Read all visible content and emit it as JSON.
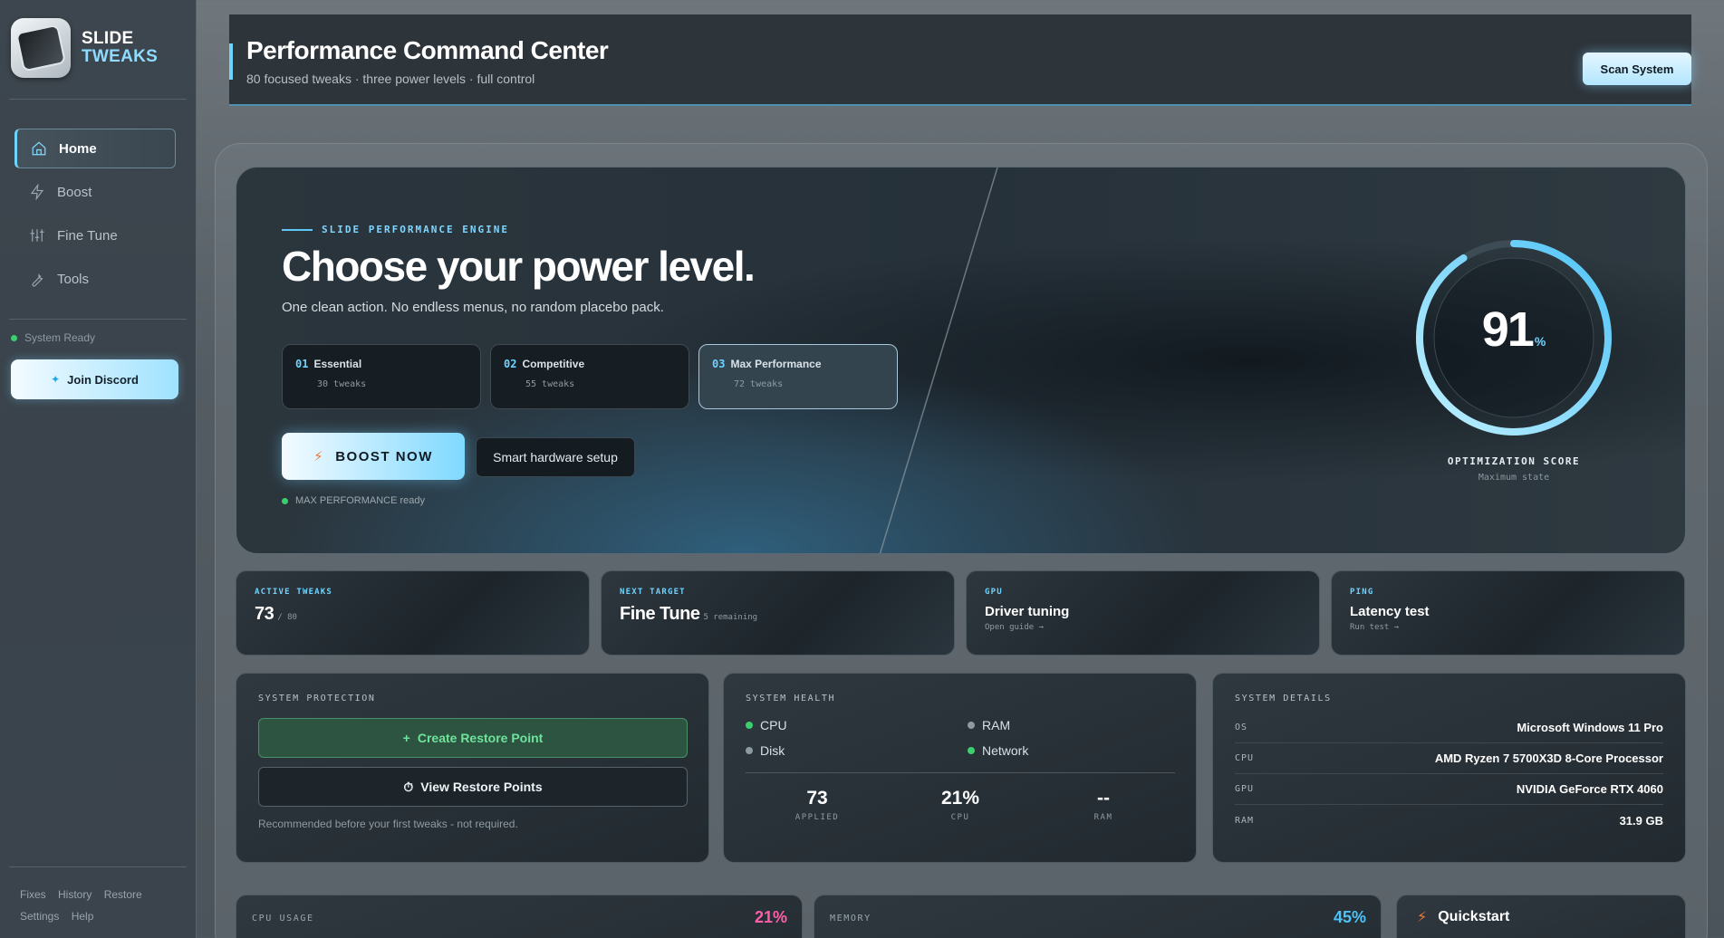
{
  "brand": {
    "line1": "SLIDE",
    "line2": "TWEAKS"
  },
  "nav": [
    {
      "label": "Home",
      "icon": "home-icon",
      "active": true
    },
    {
      "label": "Boost",
      "icon": "bolt-icon",
      "active": false
    },
    {
      "label": "Fine Tune",
      "icon": "sliders-icon",
      "active": false
    },
    {
      "label": "Tools",
      "icon": "wrench-icon",
      "active": false
    }
  ],
  "sidebar": {
    "status": "System Ready",
    "join_label": "Join Discord",
    "footer_row1": [
      "Fixes",
      "History",
      "Restore"
    ],
    "footer_row2": [
      "Settings",
      "Help"
    ]
  },
  "header": {
    "title": "Performance Command Center",
    "subtitle": "80 focused tweaks · three power levels · full control",
    "scan_label": "Scan System"
  },
  "hero": {
    "eyebrow": "SLIDE PERFORMANCE ENGINE",
    "title": "Choose your power level.",
    "subtitle": "One clean action. No endless menus, no random placebo pack.",
    "levels": [
      {
        "num": "01",
        "name": "Essential",
        "count": "30 tweaks",
        "active": false
      },
      {
        "num": "02",
        "name": "Competitive",
        "count": "55 tweaks",
        "active": false
      },
      {
        "num": "03",
        "name": "Max Performance",
        "count": "72 tweaks",
        "active": true
      }
    ],
    "boost_label": "BOOST NOW",
    "smart_label": "Smart hardware setup",
    "ready_note": "MAX PERFORMANCE ready"
  },
  "score": {
    "value": "91",
    "unit": "%",
    "fraction": 0.91,
    "label": "OPTIMIZATION SCORE",
    "sub": "Maximum state"
  },
  "tiles": [
    {
      "key": "ACTIVE TWEAKS",
      "value": "73",
      "aux": "/ 80",
      "sub": ""
    },
    {
      "key": "NEXT TARGET",
      "value": "Fine Tune",
      "aux": "5 remaining",
      "sub": ""
    },
    {
      "key": "GPU",
      "value": "Driver tuning",
      "aux": "",
      "sub": "Open guide →"
    },
    {
      "key": "PING",
      "value": "Latency test",
      "aux": "",
      "sub": "Run test →"
    }
  ],
  "protection": {
    "title": "SYSTEM PROTECTION",
    "create_label": "Create Restore Point",
    "view_label": "View Restore Points",
    "note": "Recommended before your first tweaks - not required."
  },
  "health": {
    "title": "SYSTEM HEALTH",
    "items": [
      {
        "label": "CPU",
        "color": "#3ccf6e"
      },
      {
        "label": "RAM",
        "color": "#8e9aa2"
      },
      {
        "label": "Disk",
        "color": "#8e9aa2"
      },
      {
        "label": "Network",
        "color": "#3ccf6e"
      }
    ],
    "stats": [
      {
        "value": "73",
        "label": "APPLIED"
      },
      {
        "value": "21%",
        "label": "CPU"
      },
      {
        "value": "--",
        "label": "RAM"
      }
    ]
  },
  "details": {
    "title": "SYSTEM DETAILS",
    "rows": [
      {
        "key": "OS",
        "value": "Microsoft Windows 11 Pro"
      },
      {
        "key": "CPU",
        "value": "AMD Ryzen 7 5700X3D 8-Core Processor"
      },
      {
        "key": "GPU",
        "value": "NVIDIA GeForce RTX 4060"
      },
      {
        "key": "RAM",
        "value": "31.9 GB"
      }
    ]
  },
  "bottom": {
    "cpu": {
      "title": "CPU USAGE",
      "value": "21%",
      "color": "#ff5fa8"
    },
    "memory": {
      "title": "MEMORY",
      "value": "45%",
      "color": "#4fc3f7"
    },
    "quickstart": {
      "title": "Quickstart"
    }
  },
  "colors": {
    "accent": "#6fd3ff",
    "success": "#3ccf6e",
    "warning": "#f07a3a"
  }
}
